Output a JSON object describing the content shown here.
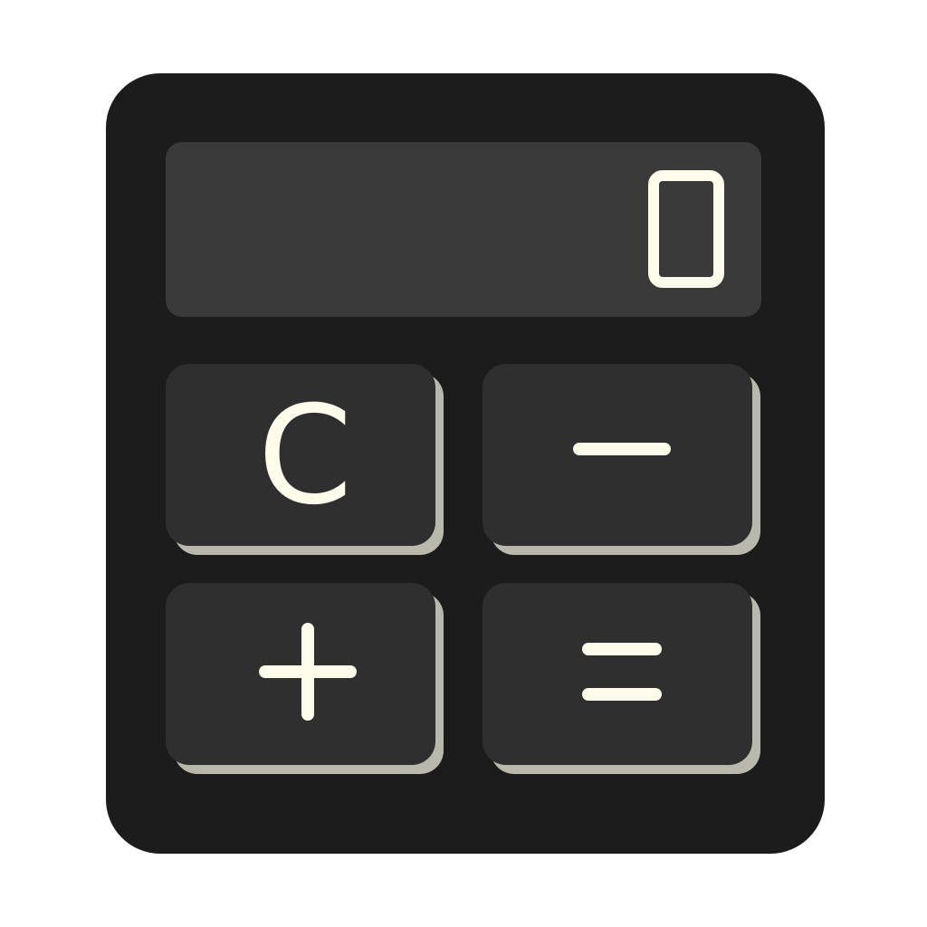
{
  "display": {
    "value": "0"
  },
  "keys": {
    "clear": "C",
    "minus": "minus-symbol",
    "plus": "plus-symbol",
    "equals": "equals-symbol"
  },
  "colors": {
    "body": "#1c1c1c",
    "display": "#3a3a3a",
    "key": "#2f2f2f",
    "key_shadow": "#b9b8ac",
    "glyph": "#fdfbea"
  }
}
